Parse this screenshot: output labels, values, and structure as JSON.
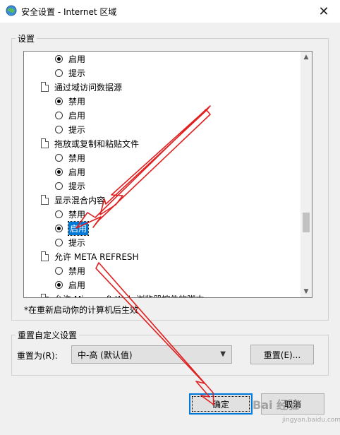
{
  "window": {
    "title": "安全设置 - Internet 区域",
    "close_glyph": "✕"
  },
  "settings_group": {
    "label": "设置"
  },
  "list": {
    "rows": [
      {
        "kind": "radio",
        "checked": true,
        "label": "启用"
      },
      {
        "kind": "radio",
        "checked": false,
        "label": "提示"
      },
      {
        "kind": "header",
        "label": "通过域访问数据源"
      },
      {
        "kind": "radio",
        "checked": true,
        "label": "禁用"
      },
      {
        "kind": "radio",
        "checked": false,
        "label": "启用"
      },
      {
        "kind": "radio",
        "checked": false,
        "label": "提示"
      },
      {
        "kind": "header",
        "label": "拖放或复制和粘贴文件"
      },
      {
        "kind": "radio",
        "checked": false,
        "label": "禁用"
      },
      {
        "kind": "radio",
        "checked": true,
        "label": "启用"
      },
      {
        "kind": "radio",
        "checked": false,
        "label": "提示"
      },
      {
        "kind": "header",
        "label": "显示混合内容"
      },
      {
        "kind": "radio",
        "checked": false,
        "label": "禁用"
      },
      {
        "kind": "radio",
        "checked": true,
        "label": "启用",
        "selected": true
      },
      {
        "kind": "radio",
        "checked": false,
        "label": "提示"
      },
      {
        "kind": "header",
        "label": "允许 META REFRESH"
      },
      {
        "kind": "radio",
        "checked": false,
        "label": "禁用"
      },
      {
        "kind": "radio",
        "checked": true,
        "label": "启用"
      },
      {
        "kind": "header",
        "label": "允许 Microsoft Web 浏览器控件的脚本"
      }
    ]
  },
  "note": "*在重新启动你的计算机后生效",
  "reset_group": {
    "label": "重置自定义设置",
    "reset_to_label": "重置为(R):",
    "select_value": "中-高 (默认值)",
    "reset_button": "重置(E)..."
  },
  "footer": {
    "ok_button": "确定",
    "cancel_button": "取消"
  },
  "watermark": {
    "text": "Bai 经验",
    "sub": "jingyan.baidu.com"
  },
  "colors": {
    "selection": "#0078d7",
    "arrow": "#e02020"
  }
}
